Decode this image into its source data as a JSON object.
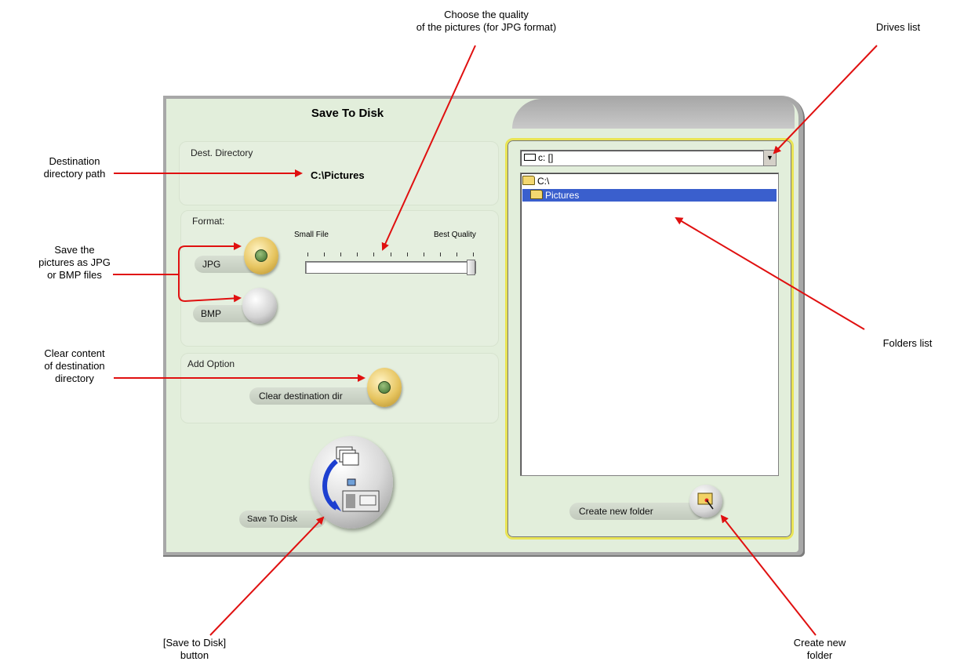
{
  "dialog": {
    "title": "Save To Disk",
    "dest_group_label": "Dest. Directory",
    "dest_path": "C:\\Pictures",
    "format_group_label": "Format:",
    "jpg_label": "JPG",
    "bmp_label": "BMP",
    "slider_min_label": "Small File",
    "slider_max_label": "Best Quality",
    "quality_value_fraction": 1.0,
    "add_option_label": "Add Option",
    "clear_dest_label": "Clear destination dir",
    "save_button_label": "Save To Disk",
    "drive_value": "c: []",
    "folders": [
      {
        "name": "C:\\",
        "selected": false
      },
      {
        "name": "Pictures",
        "selected": true
      }
    ],
    "create_folder_label": "Create new folder"
  },
  "callouts": {
    "quality": "Choose the quality\nof the pictures (for JPG format)",
    "drives": "Drives list",
    "dest_path": "Destination\ndirectory path",
    "format": "Save the\npictures as JPG\nor BMP files",
    "folders": "Folders list",
    "clear": "Clear content\nof destination\ndirectory",
    "save": "[Save to Disk]\nbutton",
    "new_folder": "Create new\nfolder"
  },
  "colors": {
    "arrow": "#e01010",
    "dialog_bg": "#e2eedb",
    "panel_border": "#e9e455",
    "selection": "#3a5fcd"
  },
  "icons": [
    "drive-icon",
    "dropdown-arrow-icon",
    "folder-open-icon",
    "monitor-icon",
    "document-stack-icon",
    "sync-arrow-icon",
    "new-folder-icon"
  ]
}
